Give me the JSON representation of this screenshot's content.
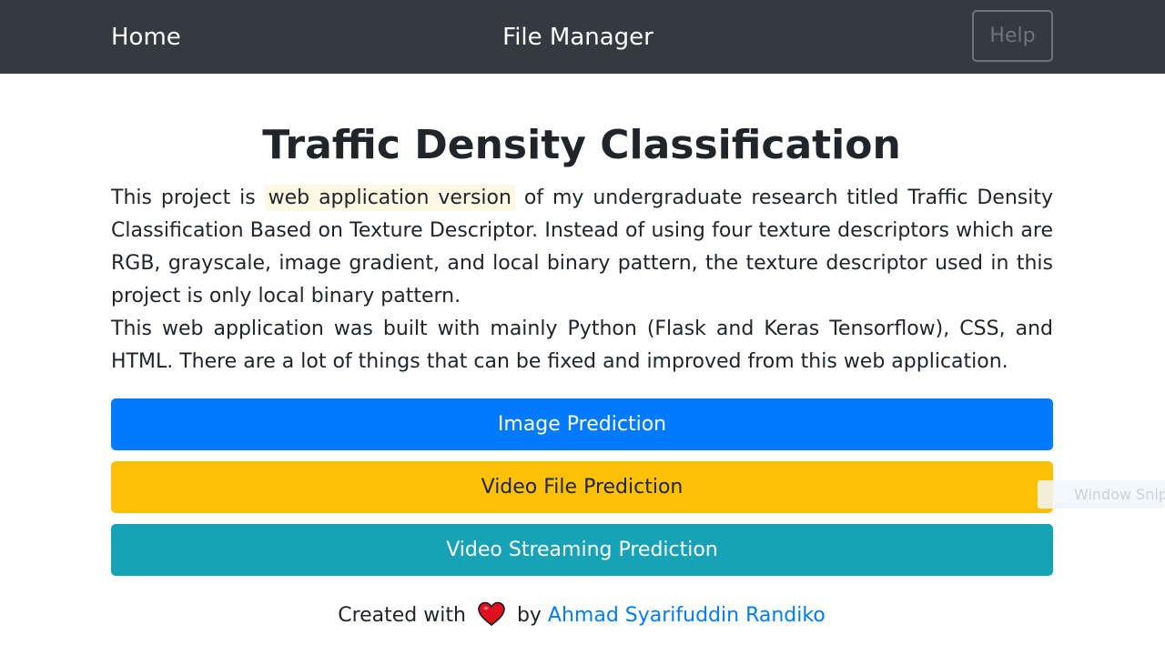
{
  "navbar": {
    "home_label": "Home",
    "center_label": "File Manager",
    "help_label": "Help"
  },
  "main": {
    "title": "Traffic Density Classification",
    "paragraph1_before": "This project is ",
    "paragraph1_highlight": "web application version",
    "paragraph1_after": " of my undergraduate research titled Traffic Density Classification Based on Texture Descriptor. Instead of using four texture descriptors which are RGB, grayscale, image gradient, and local binary pattern, the texture descriptor used in this project is only local binary pattern.",
    "paragraph2": "This web application was built with mainly Python (Flask and Keras Tensorflow), CSS, and HTML. There are a lot of things that can be fixed and improved from this web application."
  },
  "buttons": {
    "image_prediction": "Image Prediction",
    "video_file_prediction": "Video File Prediction",
    "video_streaming_prediction": "Video Streaming Prediction"
  },
  "overlay": {
    "snip_label": "Window Snip"
  },
  "footer": {
    "created_with": "Created with",
    "by": "by",
    "author": "Ahmad Syarifuddin Randiko"
  },
  "colors": {
    "navbar_bg": "#343a40",
    "primary": "#007bff",
    "warning": "#ffc107",
    "info": "#17a2b8",
    "highlight": "#fcf8e3",
    "heart": "#e0101e"
  },
  "icons": {
    "heart": "heart-icon"
  }
}
